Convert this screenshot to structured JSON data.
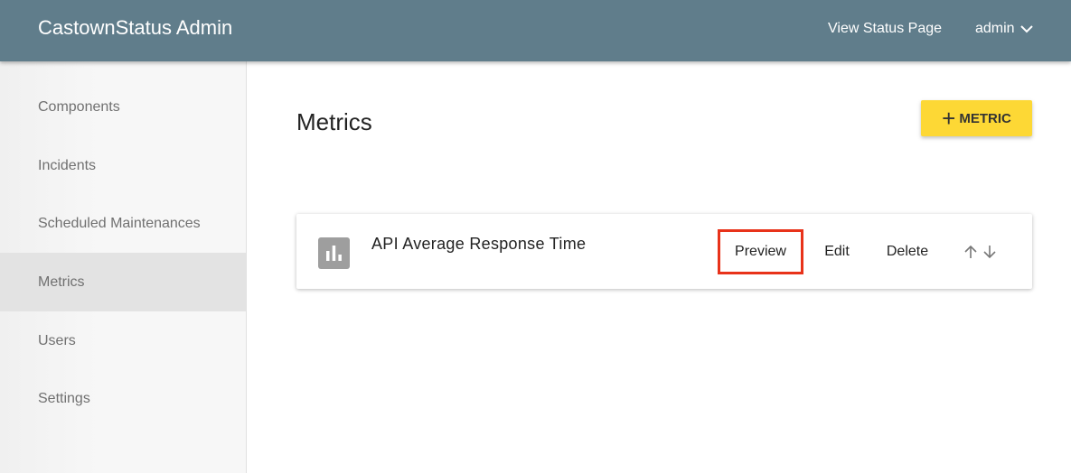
{
  "header": {
    "app_title": "CastownStatus Admin",
    "view_status_label": "View Status Page",
    "user_label": "admin"
  },
  "sidebar": {
    "items": [
      {
        "label": "Components",
        "active": false
      },
      {
        "label": "Incidents",
        "active": false
      },
      {
        "label": "Scheduled Maintenances",
        "active": false
      },
      {
        "label": "Metrics",
        "active": true
      },
      {
        "label": "Users",
        "active": false
      },
      {
        "label": "Settings",
        "active": false
      }
    ]
  },
  "main": {
    "title": "Metrics",
    "add_button_label": "METRIC",
    "metrics": [
      {
        "name": "API Average Response Time",
        "icon": "bar-chart-icon",
        "actions": {
          "preview": "Preview",
          "edit": "Edit",
          "delete": "Delete"
        }
      }
    ]
  },
  "colors": {
    "header_bg": "#607d8b",
    "accent": "#fdd835",
    "highlight": "#e8321a",
    "sidebar_active": "#e3e3e3"
  }
}
